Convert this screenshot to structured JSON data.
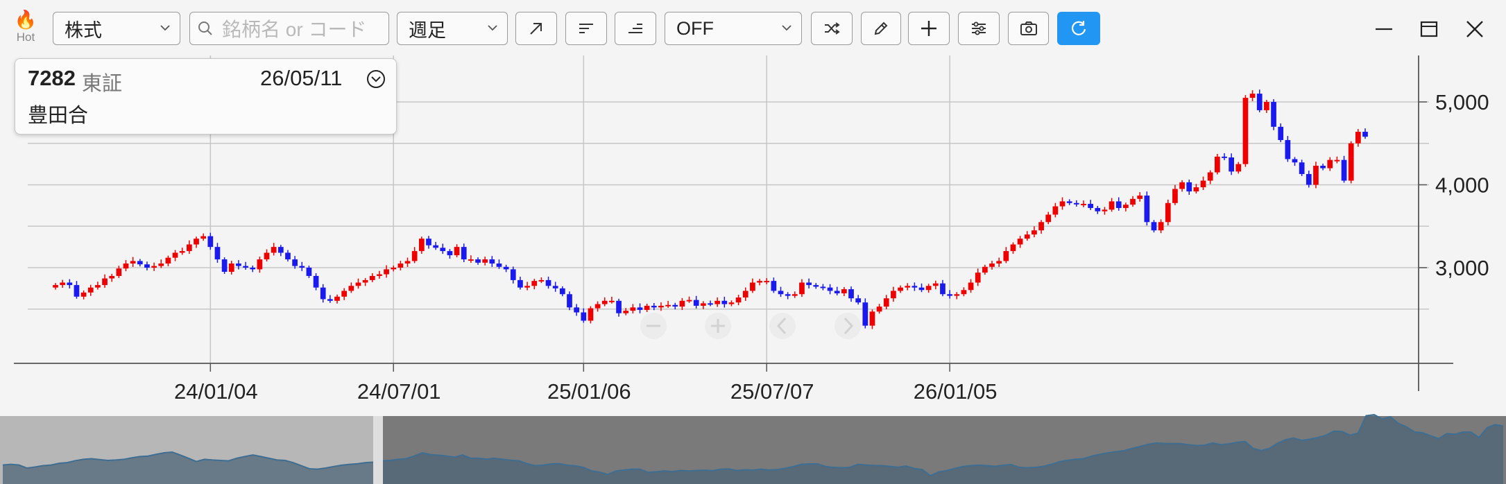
{
  "toolbar": {
    "hot_label": "Hot",
    "type_select": "株式",
    "search_placeholder": "銘柄名 or コード",
    "period_select": "週足",
    "indicator_select": "OFF"
  },
  "info_box": {
    "code": "7282",
    "market": "東証",
    "date": "26/05/11",
    "name": "豊田合"
  },
  "colors": {
    "up": "#ee0000",
    "down": "#1a1aee",
    "accent": "#2196f3",
    "navigator": "#7a7a7a"
  },
  "chart_data": {
    "type": "candlestick",
    "period": "weekly",
    "ylim": [
      2000,
      5500
    ],
    "yticks": [
      3000,
      4000,
      5000
    ],
    "ytick_labels": [
      "3,000",
      "4,000",
      "5,000"
    ],
    "xtick_labels": [
      "24/01/04",
      "24/07/01",
      "25/01/06",
      "25/07/07",
      "26/01/05"
    ],
    "xtick_week_index": [
      22,
      48,
      75,
      101,
      127
    ],
    "grid": true,
    "series": [
      {
        "values": [
          2790,
          2820,
          2790,
          2650,
          2700,
          2760,
          2790,
          2870,
          2900,
          2990,
          3050,
          3080,
          3040,
          3000,
          3020,
          3050,
          3120,
          3180,
          3200,
          3280,
          3350,
          3380,
          3250,
          3100,
          2950,
          3050,
          3020,
          3000,
          2980,
          3100,
          3180,
          3250,
          3180,
          3100,
          3020,
          3000,
          2900,
          2760,
          2620,
          2600,
          2650,
          2720,
          2780,
          2820,
          2850,
          2900,
          2920,
          2980,
          3000,
          3050,
          3080,
          3200,
          3350,
          3270,
          3240,
          3200,
          3150,
          3250,
          3100,
          3100,
          3060,
          3100,
          3050,
          3010,
          2980,
          2850,
          2760,
          2780,
          2840,
          2850,
          2780,
          2750,
          2680,
          2520,
          2460,
          2360,
          2510,
          2560,
          2600,
          2600,
          2450,
          2480,
          2520,
          2490,
          2540,
          2520,
          2540,
          2550,
          2530,
          2600,
          2610,
          2540,
          2570,
          2560,
          2600,
          2560,
          2580,
          2640,
          2720,
          2820,
          2840,
          2840,
          2720,
          2680,
          2660,
          2680,
          2820,
          2790,
          2770,
          2760,
          2720,
          2690,
          2740,
          2630,
          2580,
          2300,
          2470,
          2530,
          2630,
          2720,
          2760,
          2780,
          2760,
          2730,
          2780,
          2810,
          2680,
          2660,
          2680,
          2730,
          2820,
          2940,
          3010,
          3050,
          3080,
          3200,
          3280,
          3350,
          3400,
          3450,
          3550,
          3640,
          3740,
          3800,
          3780,
          3770,
          3770,
          3720,
          3680,
          3700,
          3800,
          3720,
          3760,
          3830,
          3870,
          3550,
          3450,
          3550,
          3780,
          3950,
          4030,
          3920,
          3970,
          4050,
          4150,
          4340,
          4330,
          4160,
          4250,
          5050,
          5100,
          4900,
          5000,
          4700,
          4540,
          4310,
          4270,
          4130,
          4000,
          4230,
          4200,
          4300,
          4300,
          4050,
          4500,
          4640,
          4580
        ]
      }
    ]
  }
}
